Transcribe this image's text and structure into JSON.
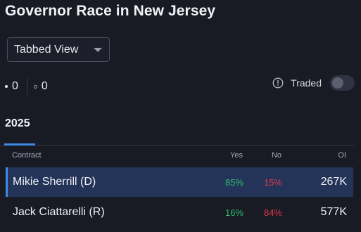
{
  "page": {
    "title": "Governor Race in New Jersey"
  },
  "view_selector": {
    "selected": "Tabbed View"
  },
  "counters": [
    {
      "value": "0"
    },
    {
      "value": "0"
    }
  ],
  "traded_toggle": {
    "label": "Traded",
    "enabled": false
  },
  "tabs": [
    {
      "label": "2025",
      "active": true
    }
  ],
  "table": {
    "columns": [
      "Contract",
      "Yes",
      "No",
      "OI"
    ],
    "rows": [
      {
        "contract": "Mikie Sherrill (D)",
        "yes": "85%",
        "no": "15%",
        "oi": "267K",
        "selected": true
      },
      {
        "contract": "Jack Ciattarelli (R)",
        "yes": "16%",
        "no": "84%",
        "oi": "577K",
        "selected": false
      }
    ]
  },
  "colors": {
    "background": "#181a24",
    "accent_blue": "#3f8ae6",
    "selected_row": "#243458",
    "yes_green": "#2ebc6e",
    "no_red": "#e0394c"
  },
  "icons": {
    "dropdown_caret": "caret-down-icon",
    "info": "info-icon",
    "counter_filled": "dot-filled-icon",
    "counter_hollow": "dot-hollow-icon"
  }
}
